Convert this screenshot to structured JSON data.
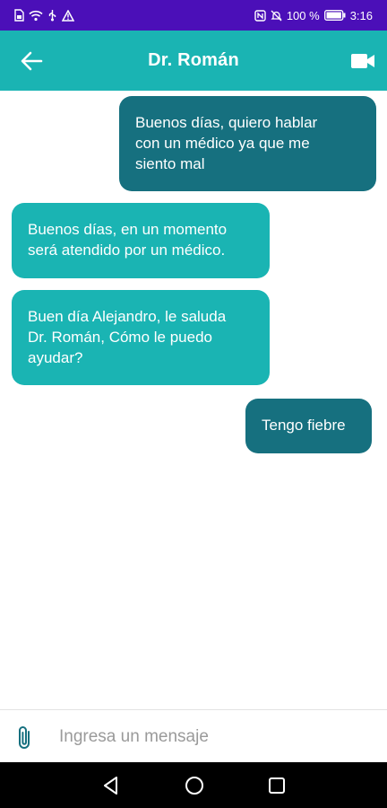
{
  "status_bar": {
    "battery_percent": "100 %",
    "time": "3:16"
  },
  "header": {
    "title": "Dr. Román",
    "back_icon": "arrow-left-icon",
    "video_icon": "video-camera-icon"
  },
  "messages": [
    {
      "side": "sent",
      "text": "Buenos días, quiero hablar\ncon un médico ya que me\nsiento mal"
    },
    {
      "side": "received",
      "text": "Buenos días, en un momento\nserá atendido por un médico."
    },
    {
      "side": "received",
      "text": "Buen día Alejandro, le saluda\nDr. Román, Cómo le puedo\nayudar?"
    },
    {
      "side": "sent",
      "text": "Tengo fiebre"
    }
  ],
  "input": {
    "placeholder": "Ingresa un mensaje",
    "value": "",
    "attach_icon": "paperclip-icon"
  },
  "colors": {
    "status_bar": "#4b0fb8",
    "app_bar": "#1ab4b3",
    "sent_bubble": "#16707f",
    "received_bubble": "#1ab4b3"
  }
}
